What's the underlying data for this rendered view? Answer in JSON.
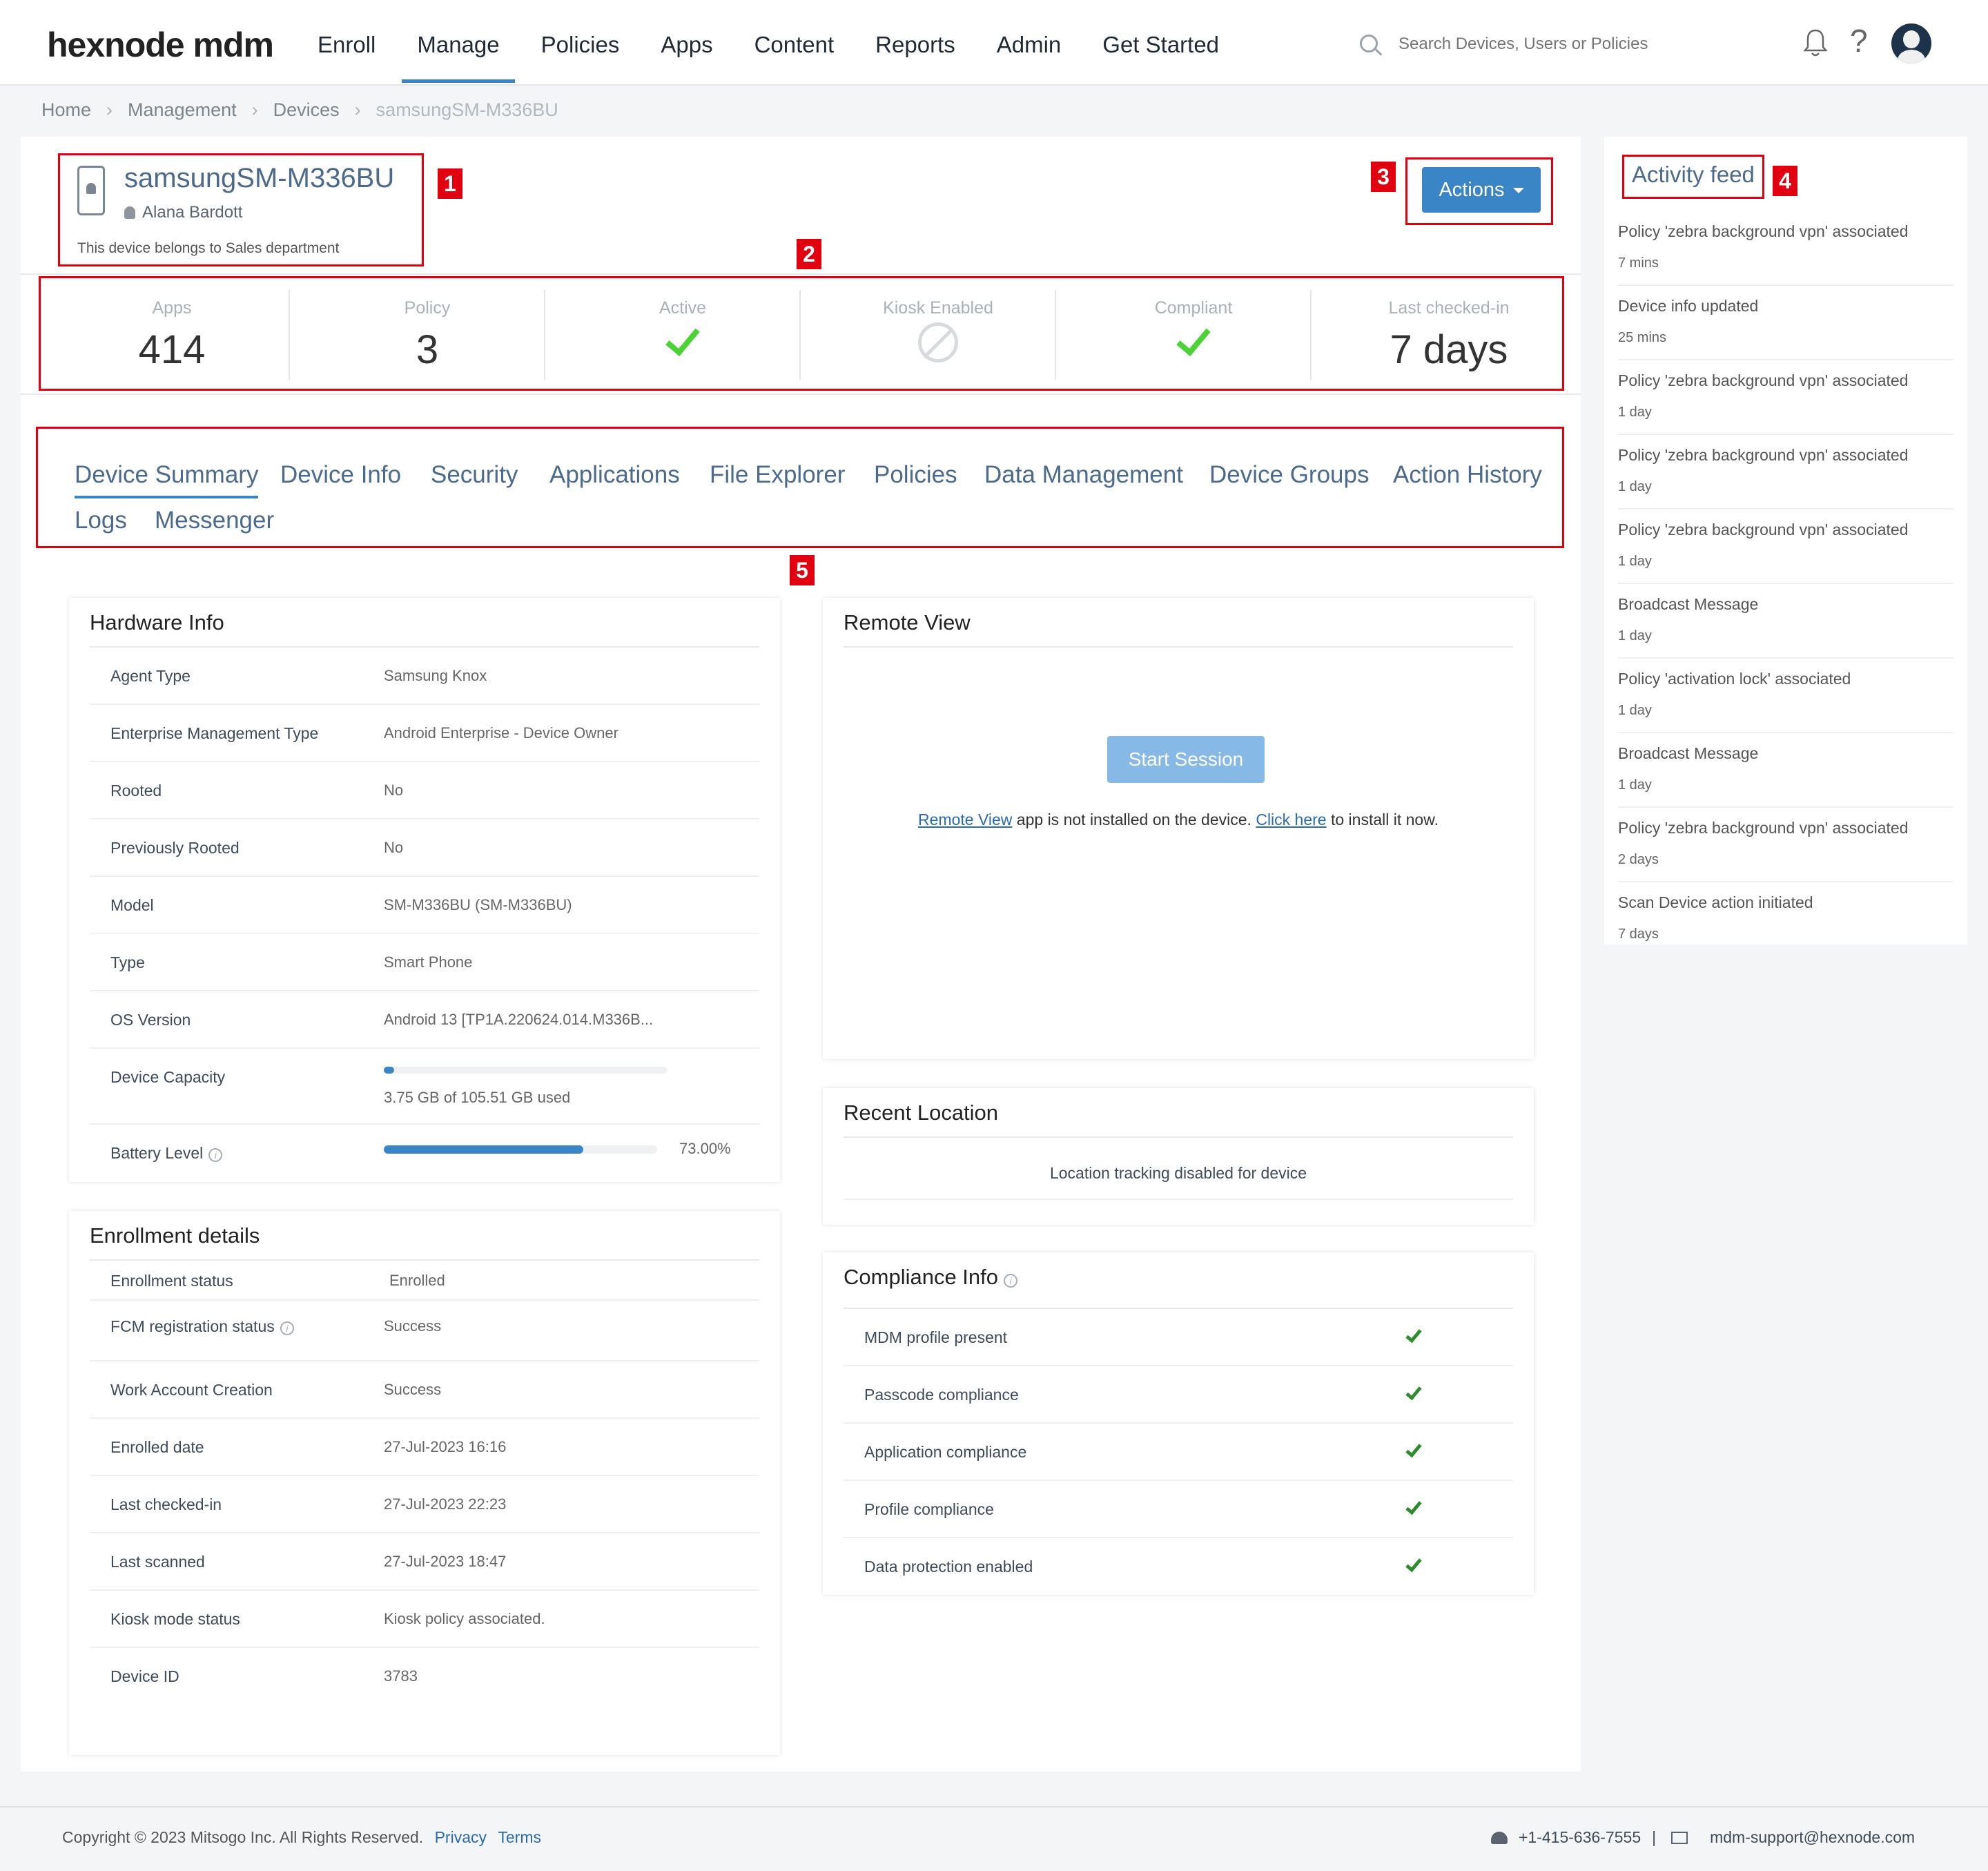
{
  "header": {
    "logo": "hexnode mdm",
    "nav": [
      "Enroll",
      "Manage",
      "Policies",
      "Apps",
      "Content",
      "Reports",
      "Admin",
      "Get Started"
    ],
    "search_placeholder": "Search Devices, Users or Policies",
    "help": "?"
  },
  "breadcrumb": [
    "Home",
    "Management",
    "Devices",
    "samsungSM-M336BU"
  ],
  "device": {
    "name": "samsungSM-M336BU",
    "user": "Alana Bardott",
    "department": "This device belongs to Sales department",
    "actions_label": "Actions"
  },
  "stats": {
    "apps_label": "Apps",
    "apps_value": "414",
    "policy_label": "Policy",
    "policy_value": "3",
    "active_label": "Active",
    "kiosk_label": "Kiosk Enabled",
    "compliant_label": "Compliant",
    "checked_label": "Last checked-in",
    "checked_value": "7 days"
  },
  "tabs": [
    "Device Summary",
    "Device Info",
    "Security",
    "Applications",
    "File Explorer",
    "Policies",
    "Data Management",
    "Device Groups",
    "Action History",
    "Logs",
    "Messenger"
  ],
  "annotations": [
    "1",
    "2",
    "3",
    "4",
    "5"
  ],
  "hardware": {
    "title": "Hardware Info",
    "rows": [
      {
        "label": "Agent Type",
        "value": "Samsung Knox"
      },
      {
        "label": "Enterprise Management Type",
        "value": "Android Enterprise - Device Owner"
      },
      {
        "label": "Rooted",
        "value": "No"
      },
      {
        "label": "Previously Rooted",
        "value": "No"
      },
      {
        "label": "Model",
        "value": "SM-M336BU (SM-M336BU)"
      },
      {
        "label": "Type",
        "value": "Smart Phone"
      },
      {
        "label": "OS Version",
        "value": "Android 13 [TP1A.220624.014.M336B..."
      }
    ],
    "capacity_label": "Device Capacity",
    "capacity_text": "3.75 GB of 105.51 GB used",
    "capacity_fraction": 0.036,
    "battery_label": "Battery Level",
    "battery_text": "73.00%",
    "battery_fraction": 0.73
  },
  "enrollment": {
    "title": "Enrollment details",
    "rows": [
      {
        "label": "Enrollment status",
        "value": "Enrolled"
      },
      {
        "label": "FCM registration status",
        "value": "Success"
      },
      {
        "label": "Work Account Creation",
        "value": "Success"
      },
      {
        "label": "Enrolled date",
        "value": "27-Jul-2023 16:16"
      },
      {
        "label": "Last checked-in",
        "value": "27-Jul-2023 22:23"
      },
      {
        "label": "Last scanned",
        "value": "27-Jul-2023 18:47"
      },
      {
        "label": "Kiosk mode status",
        "value": "Kiosk policy associated."
      },
      {
        "label": "Device ID",
        "value": "3783"
      }
    ]
  },
  "remote": {
    "title": "Remote View",
    "button": "Start Session",
    "link1": "Remote View",
    "text1": " app is not installed on the device. ",
    "link2": "Click here",
    "text2": " to install it now."
  },
  "location": {
    "title": "Recent Location",
    "message": "Location tracking disabled for device"
  },
  "compliance": {
    "title": "Compliance Info",
    "rows": [
      "MDM profile present",
      "Passcode compliance",
      "Application compliance",
      "Profile compliance",
      "Data protection enabled"
    ]
  },
  "feed": {
    "title": "Activity feed",
    "items": [
      {
        "msg": "Policy 'zebra background vpn' associated",
        "time": "7 mins"
      },
      {
        "msg": "Device info updated",
        "time": "25 mins"
      },
      {
        "msg": "Policy 'zebra background vpn' associated",
        "time": "1 day"
      },
      {
        "msg": "Policy 'zebra background vpn' associated",
        "time": "1 day"
      },
      {
        "msg": "Policy 'zebra background vpn' associated",
        "time": "1 day"
      },
      {
        "msg": "Broadcast Message",
        "time": "1 day"
      },
      {
        "msg": "Policy 'activation lock' associated",
        "time": "1 day"
      },
      {
        "msg": "Broadcast Message",
        "time": "1 day"
      },
      {
        "msg": "Policy 'zebra background vpn' associated",
        "time": "2 days"
      },
      {
        "msg": "Scan Device action initiated",
        "time": "7 days"
      }
    ]
  },
  "footer": {
    "copyright": "Copyright © 2023 Mitsogo Inc. All Rights Reserved.",
    "privacy": "Privacy",
    "terms": "Terms",
    "phone": "+1-415-636-7555",
    "separator": "|",
    "email": "mdm-support@hexnode.com"
  }
}
